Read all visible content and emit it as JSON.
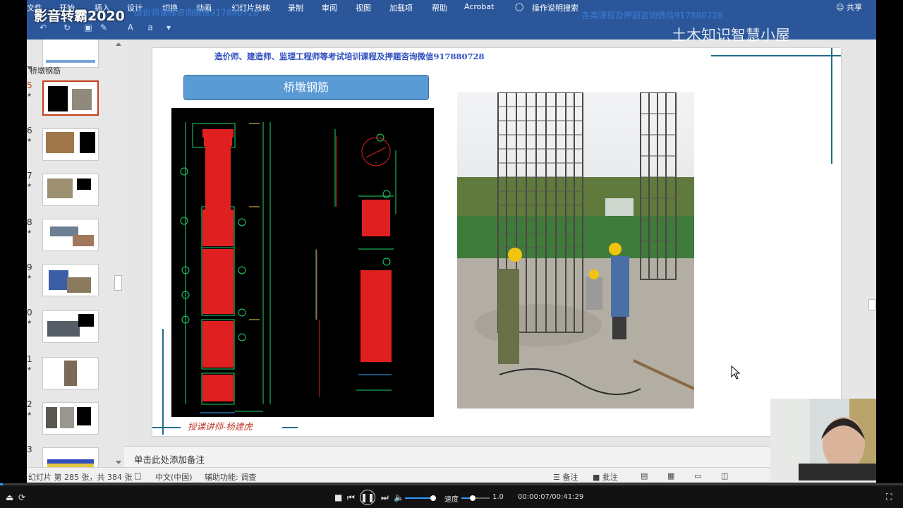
{
  "watermarks": {
    "app_brand": "影音转霸",
    "app_year": "2020",
    "channel": "土木知识智慧小屋"
  },
  "ribbon": {
    "tabs": [
      "文件",
      "开始",
      "插入",
      "设计",
      "切换",
      "动画",
      "幻灯片放映",
      "录制",
      "审阅",
      "视图",
      "加载项",
      "帮助",
      "Acrobat"
    ],
    "search_label": "操作说明搜索",
    "share_label": "共享"
  },
  "overlays": {
    "top_center": "造价师课程咨询微信917880728",
    "top_right": "各类课程及押题咨询微信917880728"
  },
  "thumbnails": {
    "section_label": "桥墩钢筋",
    "items": [
      {
        "num": "5",
        "active": true
      },
      {
        "num": "6",
        "active": false
      },
      {
        "num": "7",
        "active": false
      },
      {
        "num": "8",
        "active": false
      },
      {
        "num": "9",
        "active": false
      },
      {
        "num": "0",
        "active": false
      },
      {
        "num": "1",
        "active": false
      },
      {
        "num": "2",
        "active": false
      },
      {
        "num": "3",
        "active": false
      }
    ]
  },
  "slide": {
    "top_text": "造价师、建造师、监理工程师等考试培训课程及押题咨询微信917880728",
    "title": "桥墩钢筋",
    "lecturer": "授课讲师-杨建虎"
  },
  "notes": {
    "placeholder": "单击此处添加备注"
  },
  "statusbar": {
    "slide_info": "幻灯片 第 285 张，共 384 张",
    "language": "中文(中国)",
    "accessibility": "辅助功能: 调查",
    "notes_btn": "备注",
    "comments_btn": "批注"
  },
  "player": {
    "speed_label": "速度",
    "speed_value": "1.0",
    "time": "00:00:07/00:41:29",
    "progress_fraction": 0.003,
    "volume_fraction": 1.0,
    "speed_fraction": 0.4
  },
  "colors": {
    "ribbon": "#2b579a",
    "title_box": "#5b9bd5",
    "accent_line": "#1f6e8c",
    "lecturer": "#c0392b",
    "progress": "#2e9bff"
  }
}
